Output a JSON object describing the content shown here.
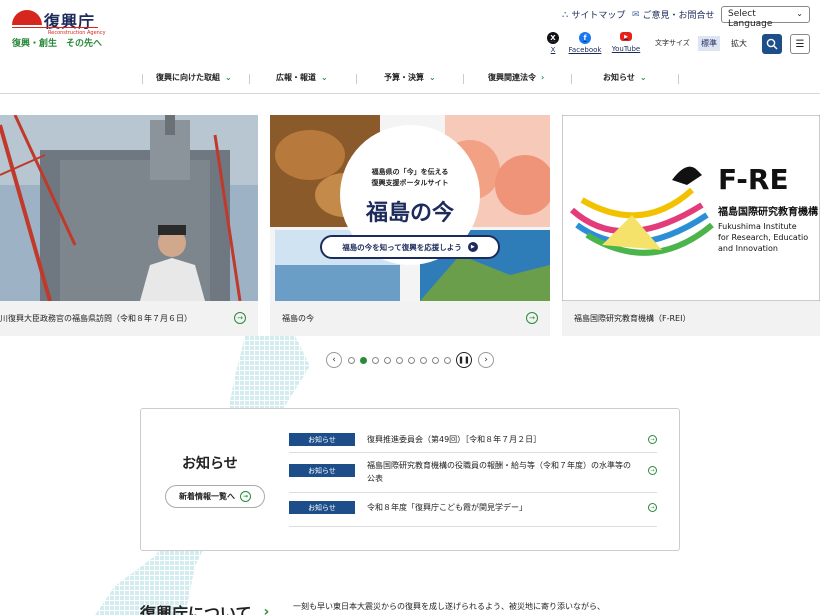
{
  "header": {
    "logo_title": "復興庁",
    "logo_sub": "Reconstruction Agency",
    "logo_tag": "復興・創生　その先へ",
    "sitemap": "サイトマップ",
    "contact": "ご意見・お問合せ",
    "language": "Select Language",
    "sns": [
      {
        "label": "X",
        "color": "#111111",
        "glyph": "𝕏"
      },
      {
        "label": "Facebook",
        "color": "#1877f2",
        "glyph": "f"
      },
      {
        "label": "YouTube",
        "color": "#e62117",
        "glyph": "▶"
      }
    ],
    "font_size_label": "文字サイズ",
    "font_standard": "標準",
    "font_large": "拡大"
  },
  "nav": [
    {
      "label": "復興に向けた取組",
      "icon": "chevron-down"
    },
    {
      "label": "広報・報道",
      "icon": "chevron-down"
    },
    {
      "label": "予算・決算",
      "icon": "chevron-down"
    },
    {
      "label": "復興関連法令",
      "icon": "chevron-right"
    },
    {
      "label": "お知らせ",
      "icon": "chevron-down"
    }
  ],
  "slides": [
    {
      "caption": "川復興大臣政務官の福島県訪問（令和８年７月６日）"
    },
    {
      "caption": "福島の今",
      "bubble_line1": "福島県の「今」を伝える",
      "bubble_line2": "復興支援ポータルサイト",
      "bubble_title": "福島の今",
      "banner": "福島の今を知って復興を応援しよう"
    },
    {
      "caption": "福島国際研究教育機構（F-REI）",
      "logo_text": "F-RE",
      "jp_name": "福島国際研究教育機構",
      "en_line1": "Fukushima Institute",
      "en_line2": "for Research, Educatio",
      "en_line3": "and Innovation"
    }
  ],
  "carousel": {
    "total": 9,
    "active": 1
  },
  "news": {
    "title": "お知らせ",
    "list_button": "新着情報一覧へ",
    "items": [
      {
        "badge": "お知らせ",
        "text": "復興推進委員会（第49回）［令和８年７月２日］"
      },
      {
        "badge": "お知らせ",
        "text": "福島国際研究教育機構の役職員の報酬・給与等（令和７年度）の水準等の公表"
      },
      {
        "badge": "お知らせ",
        "text": "令和８年度「復興庁こども霞が関見学デー」"
      }
    ]
  },
  "about": {
    "title": "復興庁について",
    "text": "一刻も早い東日本大震災からの復興を成し遂げられるよう、被災地に寄り添いながら、"
  }
}
